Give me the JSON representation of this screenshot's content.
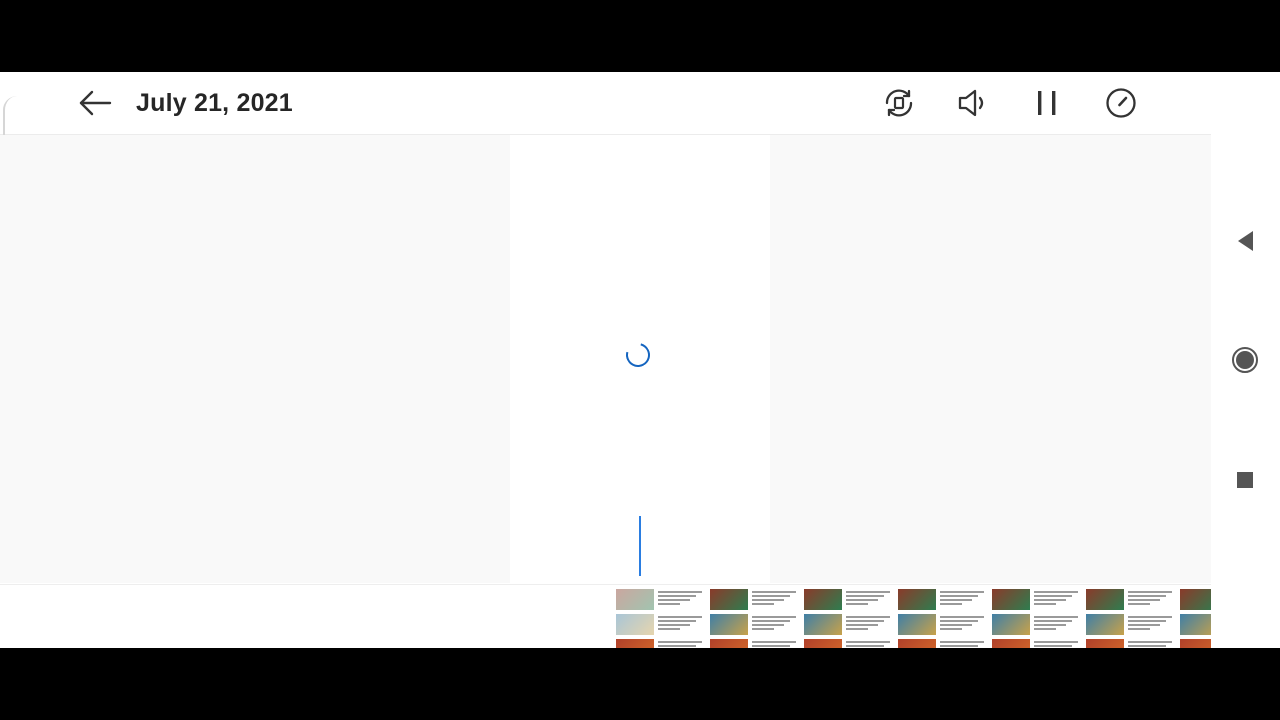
{
  "header": {
    "title": "July 21, 2021"
  },
  "icons": {
    "back": "arrow-left-icon",
    "rotate": "rotate-screen-icon",
    "volume": "volume-icon",
    "pause": "pause-icon",
    "speed": "playback-speed-icon",
    "loading": "loading-spinner-icon",
    "nav_back": "nav-back-triangle-icon",
    "nav_home": "nav-home-circle-icon",
    "nav_recents": "nav-recents-square-icon"
  },
  "colors": {
    "accent": "#1565c0",
    "scrubber": "#2a7de1"
  },
  "timeline": {
    "thumbnail_count": 7,
    "scrubber_position_fraction": 0.04
  }
}
